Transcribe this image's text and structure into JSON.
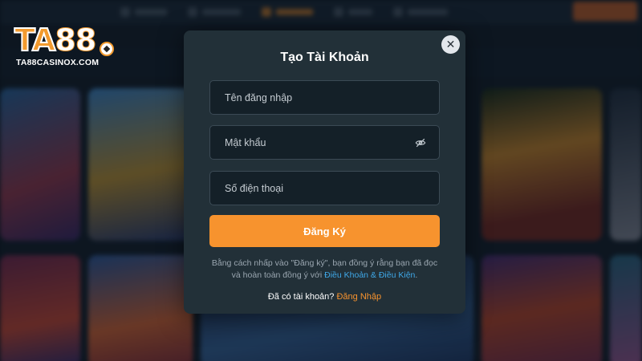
{
  "brand": {
    "logo_prefix": "TA",
    "logo_number": "88",
    "site": "TA88CASINOX.COM"
  },
  "modal": {
    "title": "Tạo Tài Khoản",
    "close_icon": "close-icon",
    "fields": {
      "username": {
        "placeholder": "Tên đăng nhập",
        "value": ""
      },
      "password": {
        "placeholder": "Mật khẩu",
        "value": "",
        "toggle_icon": "eye-slash-icon"
      },
      "phone": {
        "placeholder": "Số điện thoại",
        "value": ""
      }
    },
    "submit_label": "Đăng Ký",
    "terms_text": "Bằng cách nhấp vào \"Đăng ký\", bạn đồng ý rằng bạn đã đọc và hoàn toàn đồng ý với",
    "terms_link": "Điều Khoản & Điều Kiện",
    "terms_end": ".",
    "login_prompt": "Đã có tài khoản?",
    "login_link": "Đăng Nhập"
  },
  "colors": {
    "accent": "#f7932e",
    "link_blue": "#3fa8e8",
    "modal_bg": "#223038",
    "field_bg": "#142028"
  }
}
